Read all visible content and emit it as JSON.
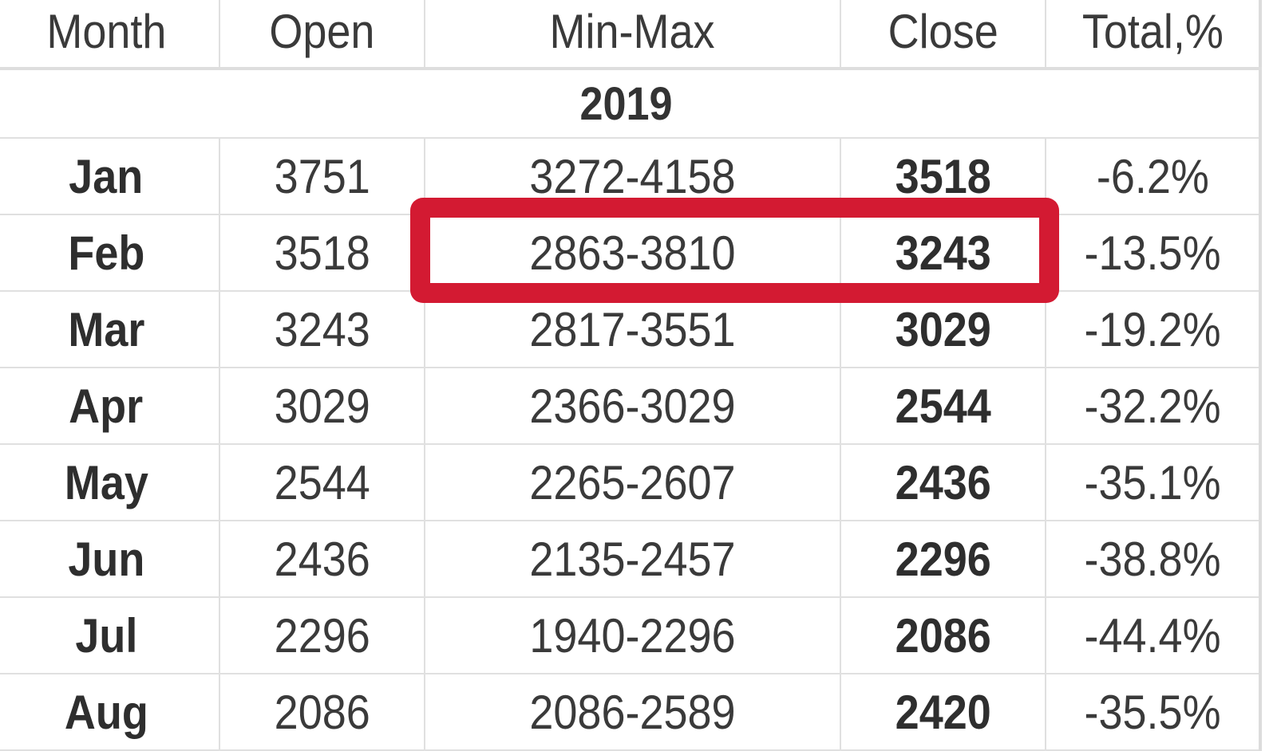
{
  "table": {
    "headers": [
      "Month",
      "Open",
      "Min-Max",
      "Close",
      "Total,%"
    ],
    "year_label": "2019",
    "rows": [
      {
        "month": "Jan",
        "open": "3751",
        "minmax": "3272-4158",
        "close": "3518",
        "total": "-6.2%"
      },
      {
        "month": "Feb",
        "open": "3518",
        "minmax": "2863-3810",
        "close": "3243",
        "total": "-13.5%"
      },
      {
        "month": "Mar",
        "open": "3243",
        "minmax": "2817-3551",
        "close": "3029",
        "total": "-19.2%"
      },
      {
        "month": "Apr",
        "open": "3029",
        "minmax": "2366-3029",
        "close": "2544",
        "total": "-32.2%"
      },
      {
        "month": "May",
        "open": "2544",
        "minmax": "2265-2607",
        "close": "2436",
        "total": "-35.1%"
      },
      {
        "month": "Jun",
        "open": "2436",
        "minmax": "2135-2457",
        "close": "2296",
        "total": "-38.8%"
      },
      {
        "month": "Jul",
        "open": "2296",
        "minmax": "1940-2296",
        "close": "2086",
        "total": "-44.4%"
      },
      {
        "month": "Aug",
        "open": "2086",
        "minmax": "2086-2589",
        "close": "2420",
        "total": "-35.5%"
      }
    ]
  },
  "highlight": {
    "row": "Feb",
    "columns": [
      "Min-Max",
      "Close"
    ],
    "color": "#d31a32"
  }
}
